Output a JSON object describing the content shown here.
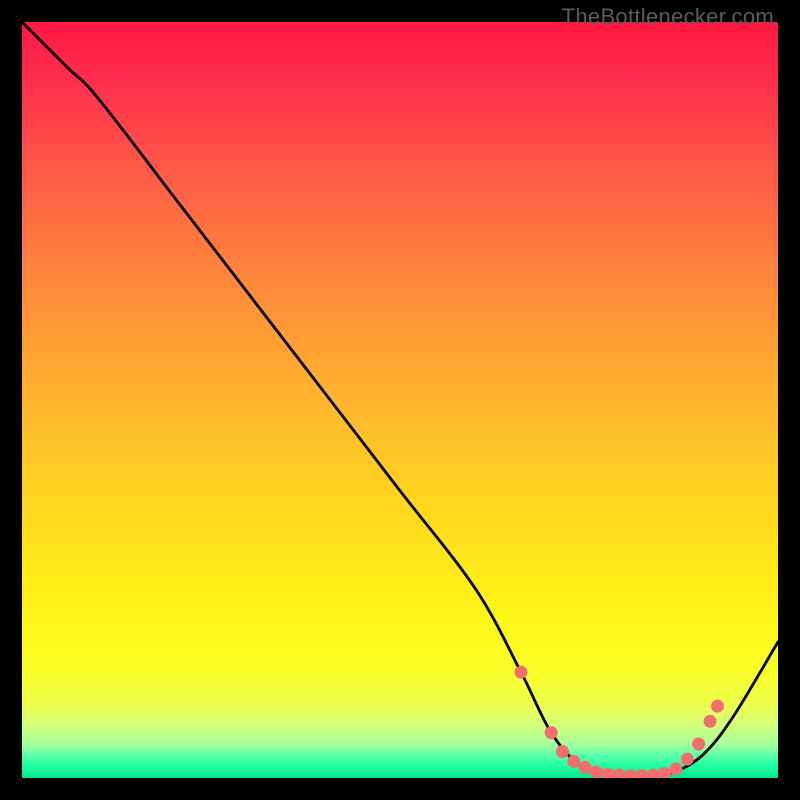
{
  "watermark": "TheBottlenecker.com",
  "chart_data": {
    "type": "line",
    "title": "",
    "xlabel": "",
    "ylabel": "",
    "xlim": [
      0,
      100
    ],
    "ylim": [
      0,
      100
    ],
    "grid": false,
    "legend": false,
    "background": "red-yellow-green vertical gradient with green band at bottom",
    "series": [
      {
        "name": "curve",
        "color": "#000000",
        "x": [
          0,
          6,
          10,
          20,
          30,
          40,
          50,
          60,
          66,
          70,
          74,
          78,
          82,
          86,
          90,
          94,
          100
        ],
        "y": [
          100,
          94,
          90,
          77,
          64,
          51,
          38,
          25,
          14,
          6,
          1.5,
          0.4,
          0.3,
          0.7,
          3,
          8,
          18
        ]
      }
    ],
    "markers": {
      "name": "dots",
      "color": "#f26e6e",
      "x": [
        66,
        70,
        71.5,
        73,
        74.5,
        76,
        77.5,
        79,
        80.5,
        82,
        83.5,
        85,
        86.5,
        88,
        89.5,
        91,
        92
      ],
      "y": [
        14,
        6,
        3.5,
        2.2,
        1.4,
        0.8,
        0.5,
        0.4,
        0.3,
        0.3,
        0.4,
        0.6,
        1.2,
        2.5,
        4.5,
        7.5,
        9.5
      ]
    }
  }
}
